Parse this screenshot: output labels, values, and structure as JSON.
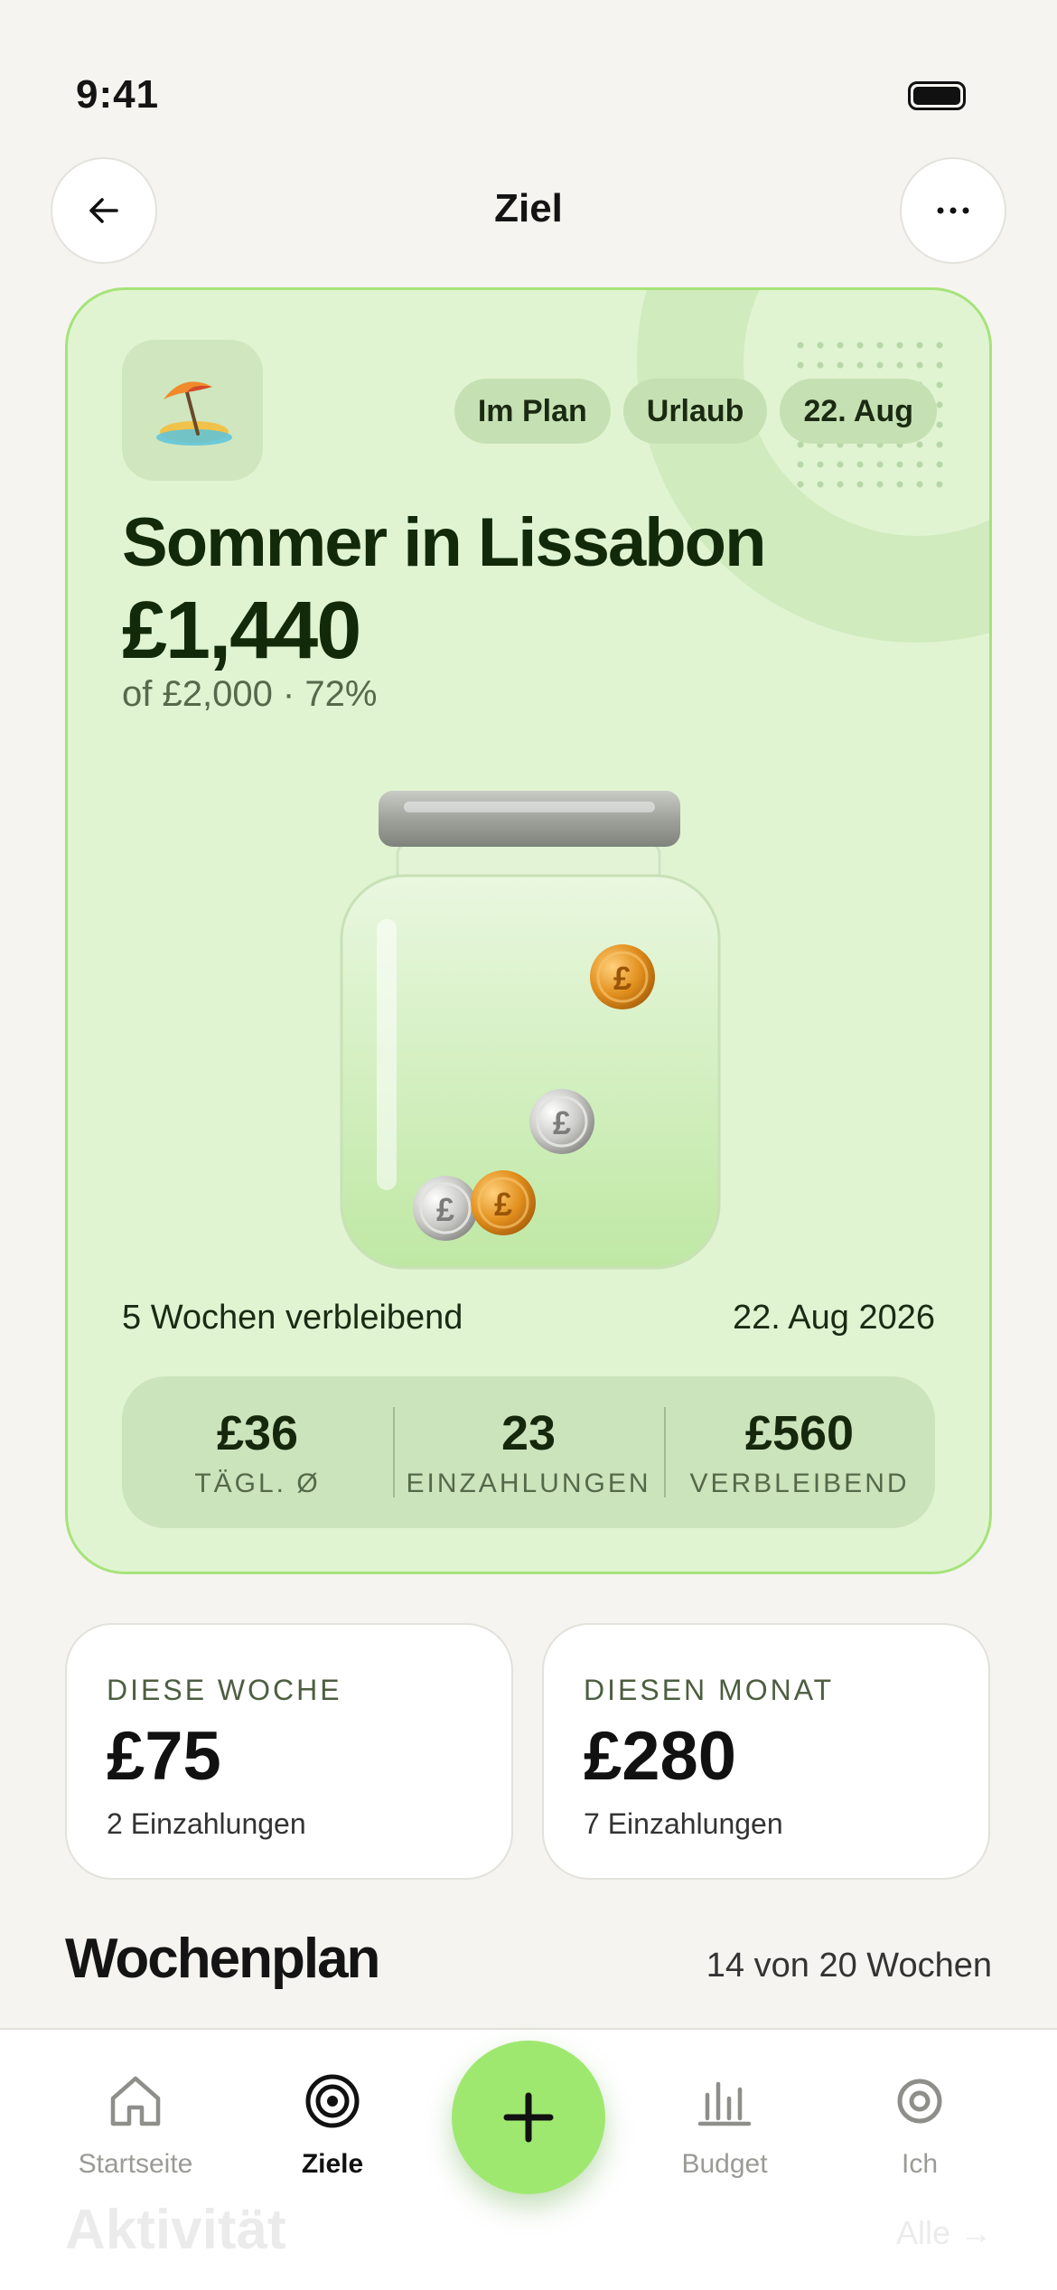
{
  "status_bar": {
    "time": "9:41"
  },
  "header": {
    "title": "Ziel"
  },
  "goal": {
    "emoji": "🏝️",
    "tags": [
      "Im Plan",
      "Urlaub",
      "22. Aug"
    ],
    "title": "Sommer in Lissabon",
    "amount": "£1,440",
    "subtitle": "of £2,000 · 72%",
    "progress_fraction": 0.72,
    "weeks_left": "5 Wochen verbleibend",
    "target_date": "22. Aug 2026",
    "stats": [
      {
        "value": "£36",
        "label": "TÄGL. Ø"
      },
      {
        "value": "23",
        "label": "EINZAHLUNGEN"
      },
      {
        "value": "£560",
        "label": "VERBLEIBEND"
      }
    ]
  },
  "summary": {
    "week": {
      "label": "DIESE WOCHE",
      "value": "£75",
      "count": "2 Einzahlungen"
    },
    "month": {
      "label": "DIESEN MONAT",
      "value": "£280",
      "count": "7 Einzahlungen"
    }
  },
  "weekly_plan": {
    "title": "Wochenplan",
    "meta": "14 von 20 Wochen"
  },
  "activity": {
    "title": "Aktivität",
    "link": "Alle →"
  },
  "nav": {
    "items": [
      {
        "label": "Startseite"
      },
      {
        "label": "Ziele"
      },
      {
        "label": "Budget"
      },
      {
        "label": "Ich"
      }
    ]
  },
  "colors": {
    "accent": "#9fe870",
    "card_bg": "#e0f4d2",
    "card_border": "#a6e37a",
    "title_dark": "#122a0a"
  }
}
